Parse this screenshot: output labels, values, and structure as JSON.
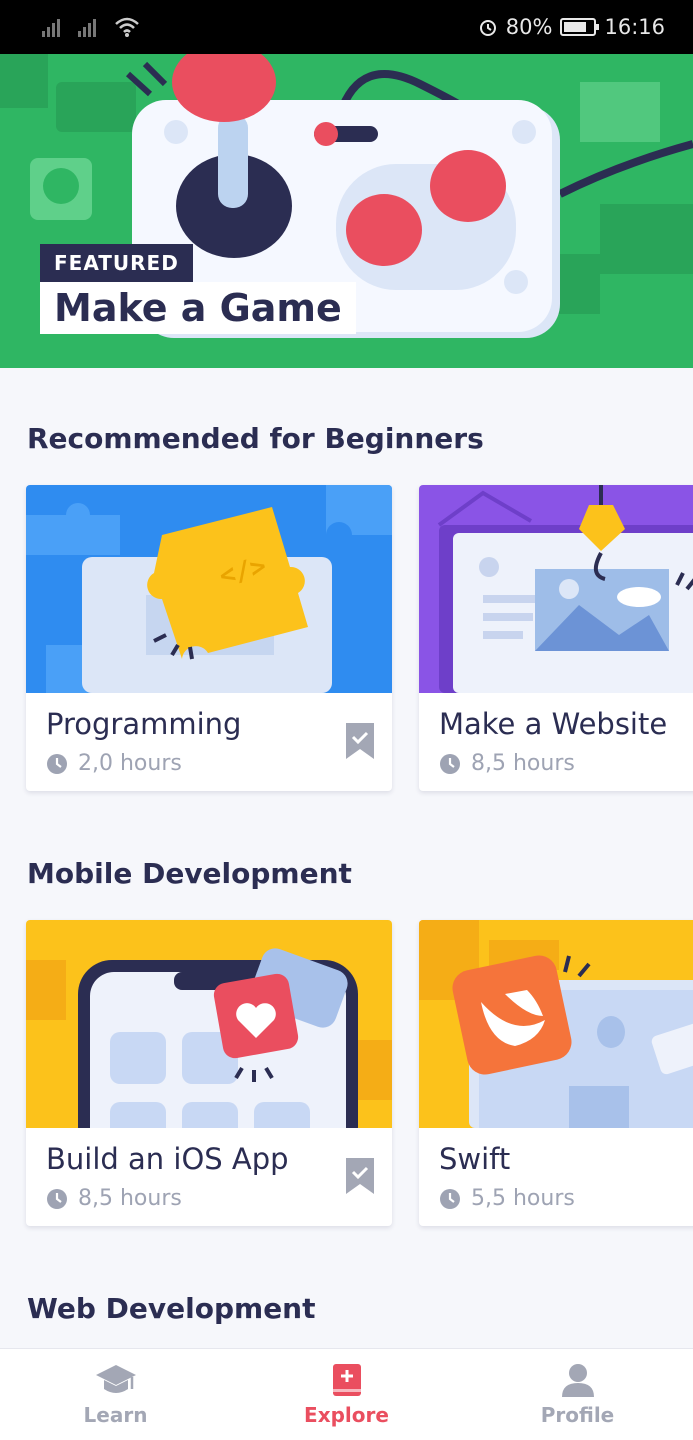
{
  "status_bar": {
    "battery": "80%",
    "time": "16:16"
  },
  "hero": {
    "tag": "FEATURED",
    "title": "Make a Game"
  },
  "sections": [
    {
      "title": "Recommended for Beginners",
      "cards": [
        {
          "title": "Programming",
          "duration": "2,0 hours",
          "bookmark": true
        },
        {
          "title": "Make a Website",
          "duration": "8,5 hours",
          "bookmark": false
        }
      ]
    },
    {
      "title": "Mobile Development",
      "cards": [
        {
          "title": "Build an iOS App",
          "duration": "8,5 hours",
          "bookmark": true
        },
        {
          "title": "Swift",
          "duration": "5,5 hours",
          "bookmark": false
        }
      ]
    },
    {
      "title": "Web Development"
    }
  ],
  "tabbar": {
    "items": [
      {
        "label": "Learn",
        "icon": "graduation-cap-icon",
        "active": false
      },
      {
        "label": "Explore",
        "icon": "book-plus-icon",
        "active": true
      },
      {
        "label": "Profile",
        "icon": "person-icon",
        "active": false
      }
    ]
  },
  "colors": {
    "hero_green": "#2fb663",
    "navy": "#2b2d52",
    "accent_red": "#ea4e5f",
    "muted": "#9ea3b3"
  }
}
